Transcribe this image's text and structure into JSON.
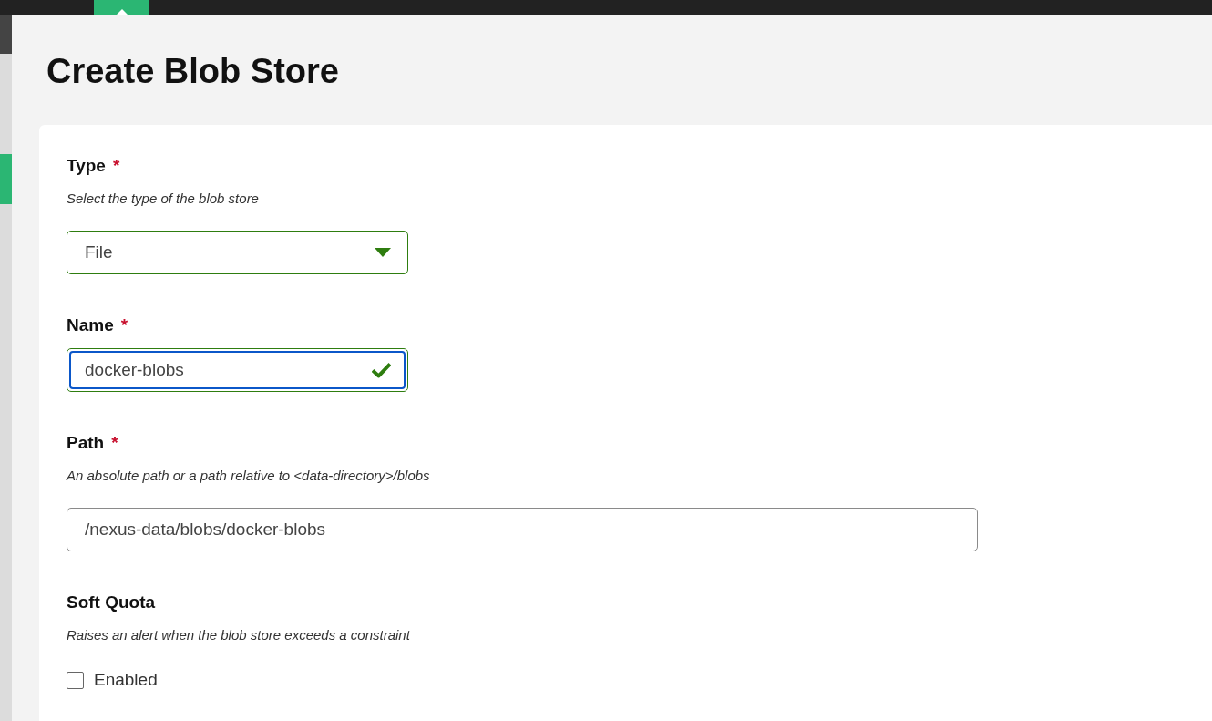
{
  "page": {
    "title": "Create Blob Store"
  },
  "fields": [
    {
      "kind": "select",
      "label": "Type",
      "required_mark": "*",
      "description": "Select the type of the blob store",
      "value": "File",
      "valid": true
    },
    {
      "kind": "text",
      "label": "Name",
      "required_mark": "*",
      "value": "docker-blobs",
      "valid": true,
      "focused": true
    },
    {
      "kind": "path",
      "label": "Path",
      "required_mark": "*",
      "description": "An absolute path or a path relative to <data-directory>/blobs",
      "value": "/nexus-data/blobs/docker-blobs",
      "valid": false,
      "focused": false
    },
    {
      "kind": "checkbox",
      "label": "Soft Quota",
      "description": "Raises an alert when the blob store exceeds a constraint",
      "option": {
        "label": "Enabled",
        "checked": false
      }
    }
  ]
}
